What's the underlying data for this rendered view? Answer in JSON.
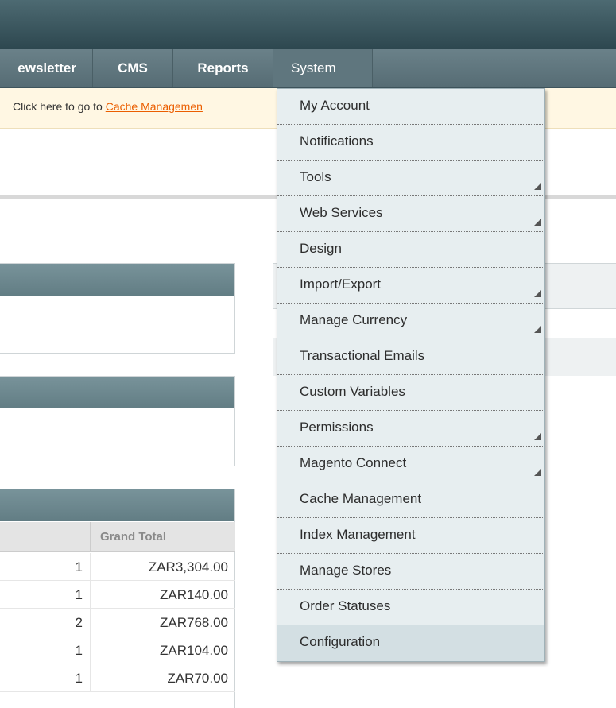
{
  "nav": {
    "items": [
      {
        "label": "ewsletter"
      },
      {
        "label": "CMS"
      },
      {
        "label": "Reports"
      },
      {
        "label": "System"
      }
    ]
  },
  "notice": {
    "text": "Click here to go to ",
    "link": "Cache Managemen"
  },
  "system_menu": {
    "items": [
      {
        "label": "My Account",
        "submenu": false
      },
      {
        "label": "Notifications",
        "submenu": false
      },
      {
        "label": "Tools",
        "submenu": true
      },
      {
        "label": "Web Services",
        "submenu": true
      },
      {
        "label": "Design",
        "submenu": false
      },
      {
        "label": "Import/Export",
        "submenu": true
      },
      {
        "label": "Manage Currency",
        "submenu": true
      },
      {
        "label": "Transactional Emails",
        "submenu": false
      },
      {
        "label": "Custom Variables",
        "submenu": false
      },
      {
        "label": "Permissions",
        "submenu": true
      },
      {
        "label": "Magento Connect",
        "submenu": true
      },
      {
        "label": "Cache Management",
        "submenu": false
      },
      {
        "label": "Index Management",
        "submenu": false
      },
      {
        "label": "Manage Stores",
        "submenu": false
      },
      {
        "label": "Order Statuses",
        "submenu": false
      },
      {
        "label": "Configuration",
        "submenu": false
      }
    ]
  },
  "orders_table": {
    "header": "Grand Total",
    "rows": [
      {
        "qty": "1",
        "total": "ZAR3,304.00"
      },
      {
        "qty": "1",
        "total": "ZAR140.00"
      },
      {
        "qty": "2",
        "total": "ZAR768.00"
      },
      {
        "qty": "1",
        "total": "ZAR104.00"
      },
      {
        "qty": "1",
        "total": "ZAR70.00"
      }
    ]
  },
  "colors": {
    "header_bg": "#2d474f",
    "nav_bg": "#6a8189",
    "notice_bg": "#fff7e3",
    "link": "#eb5e00",
    "menu_bg": "#e7eef0"
  }
}
